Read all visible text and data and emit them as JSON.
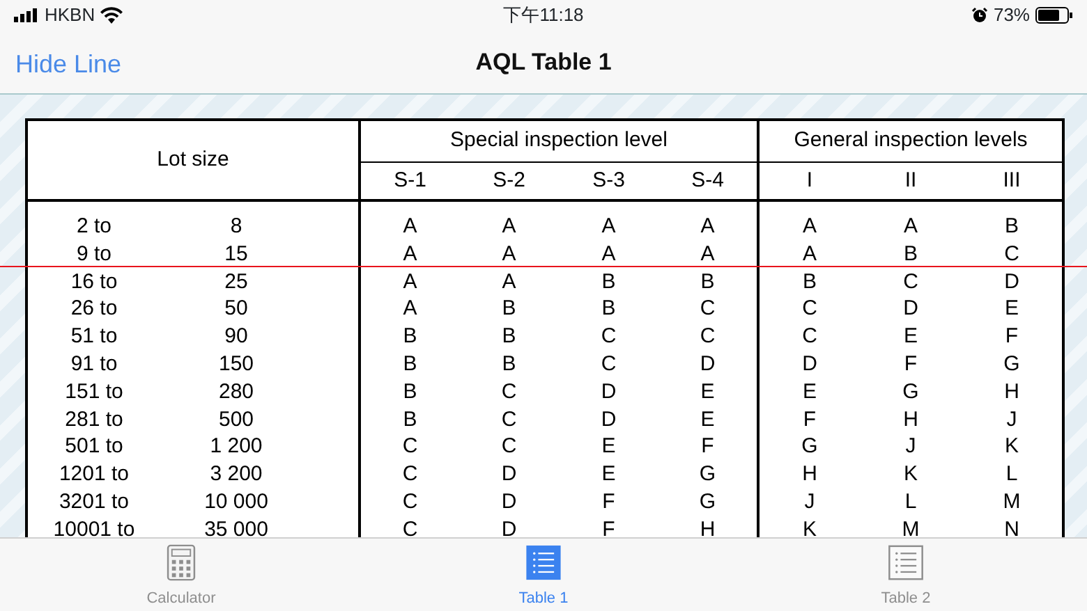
{
  "status_bar": {
    "carrier": "HKBN",
    "time": "下午11:18",
    "battery": "73%"
  },
  "nav_bar": {
    "left_button": "Hide Line",
    "title": "AQL Table 1"
  },
  "guide_line": {
    "visible": true
  },
  "table": {
    "lot_header": "Lot size",
    "groups": [
      {
        "label": "Special inspection level",
        "columns": [
          "S-1",
          "S-2",
          "S-3",
          "S-4"
        ]
      },
      {
        "label": "General inspection levels",
        "columns": [
          "I",
          "II",
          "III"
        ]
      }
    ],
    "rows": [
      {
        "from": "2 to",
        "to": "8",
        "codes": [
          "A",
          "A",
          "A",
          "A",
          "A",
          "A",
          "B"
        ]
      },
      {
        "from": "9 to",
        "to": "15",
        "codes": [
          "A",
          "A",
          "A",
          "A",
          "A",
          "B",
          "C"
        ]
      },
      {
        "from": "16 to",
        "to": "25",
        "codes": [
          "A",
          "A",
          "B",
          "B",
          "B",
          "C",
          "D"
        ]
      },
      {
        "from": "26 to",
        "to": "50",
        "codes": [
          "A",
          "B",
          "B",
          "C",
          "C",
          "D",
          "E"
        ]
      },
      {
        "from": "51 to",
        "to": "90",
        "codes": [
          "B",
          "B",
          "C",
          "C",
          "C",
          "E",
          "F"
        ]
      },
      {
        "from": "91 to",
        "to": "150",
        "codes": [
          "B",
          "B",
          "C",
          "D",
          "D",
          "F",
          "G"
        ]
      },
      {
        "from": "151 to",
        "to": "280",
        "codes": [
          "B",
          "C",
          "D",
          "E",
          "E",
          "G",
          "H"
        ]
      },
      {
        "from": "281 to",
        "to": "500",
        "codes": [
          "B",
          "C",
          "D",
          "E",
          "F",
          "H",
          "J"
        ]
      },
      {
        "from": "501 to",
        "to": "1 200",
        "codes": [
          "C",
          "C",
          "E",
          "F",
          "G",
          "J",
          "K"
        ]
      },
      {
        "from": "1201 to",
        "to": "3 200",
        "codes": [
          "C",
          "D",
          "E",
          "G",
          "H",
          "K",
          "L"
        ]
      },
      {
        "from": "3201 to",
        "to": "10 000",
        "codes": [
          "C",
          "D",
          "F",
          "G",
          "J",
          "L",
          "M"
        ]
      },
      {
        "from": "10001 to",
        "to": "35 000",
        "codes": [
          "C",
          "D",
          "F",
          "H",
          "K",
          "M",
          "N"
        ]
      }
    ]
  },
  "tab_bar": [
    {
      "label": "Calculator",
      "kind": "calculator",
      "selected": false
    },
    {
      "label": "Table 1",
      "kind": "list",
      "selected": true
    },
    {
      "label": "Table 2",
      "kind": "list",
      "selected": false
    }
  ]
}
